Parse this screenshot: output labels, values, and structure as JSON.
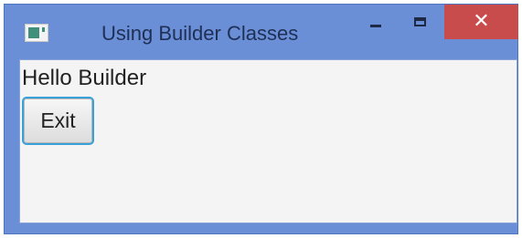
{
  "window": {
    "title": "Using Builder Classes",
    "controls": {
      "minimize": "minimize-icon",
      "maximize": "maximize-icon",
      "close_glyph": "✕"
    },
    "colors": {
      "frame": "#6b8fd6",
      "close_button": "#c84c4c",
      "focus_ring": "#39a0d8"
    }
  },
  "content": {
    "label": "Hello Builder",
    "exit_button_label": "Exit"
  }
}
